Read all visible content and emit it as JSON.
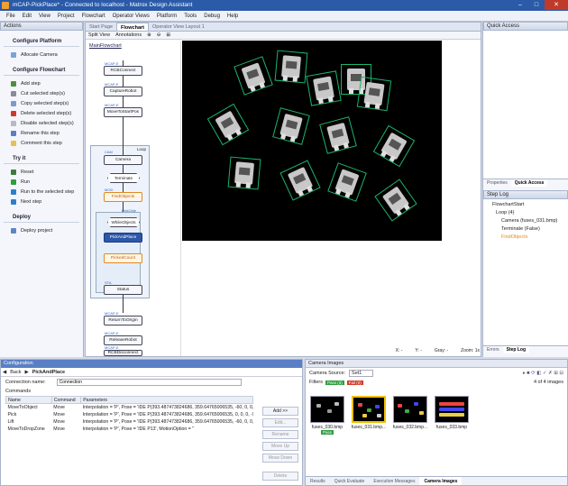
{
  "window": {
    "title": "mCAP-PickPlace* - Connected to localhost - Matrox Design Assistant"
  },
  "menu": [
    "File",
    "Edit",
    "View",
    "Project",
    "Flowchart",
    "Operator Views",
    "Platform",
    "Tools",
    "Debug",
    "Help"
  ],
  "actions": {
    "title": "Actions",
    "sections": [
      {
        "title": "Configure Platform",
        "items": [
          "Allocate Camera"
        ]
      },
      {
        "title": "Configure Flowchart",
        "items": [
          "Add step",
          "Cut selected step(s)",
          "Copy selected step(s)",
          "Delete selected step(s)",
          "Disable selected step(s)",
          "Rename this step",
          "Comment this step"
        ]
      },
      {
        "title": "Try it",
        "items": [
          "Reset",
          "Run",
          "Run to the selected step",
          "Next step"
        ]
      },
      {
        "title": "Deploy",
        "items": [
          "Deploy project"
        ]
      }
    ]
  },
  "center": {
    "tabs": [
      "Start Page",
      "Flowchart",
      "Operator View Layout 1"
    ],
    "toolbar": [
      "Split View",
      "Annotations"
    ],
    "flow_title": "MainFlowchart",
    "loop_label": "Loop",
    "nodes": {
      "rcbconnect": "RCBConnect",
      "capture": "CaptureRobot",
      "movetostart": "MoveToStartPos",
      "camera": "Camera",
      "terminate": "Terminate",
      "findobjects": "FindObjects",
      "whileobjects": "WhileObjects",
      "pickandplace": "PickAndPlace",
      "pickedcount": "PickedCount",
      "status": "Status",
      "returntoorigin": "ReturnToOrigin",
      "releaserobot": "ReleaseRobot",
      "rcbdisconnect": "RCBDisconnect"
    },
    "tags": {
      "mcap": "MCAP-E",
      "cam": "CAM",
      "mod": "MOD",
      "pick": "PickObje",
      "sta": "STA"
    },
    "coords": {
      "x": "X: -",
      "y": "Y: -",
      "gray": "Gray: -",
      "zoom": "Zoom: 1x"
    }
  },
  "right": {
    "quick_access": "Quick Access",
    "tabs1": [
      "Properties",
      "Quick Access"
    ],
    "step_log": "Step Log",
    "tree": [
      "FlowchartStart",
      "Loop (4)",
      "Camera (fuses_031.bmp)",
      "Terminate (False)",
      "FindObjects"
    ],
    "tabs2": [
      "Errors",
      "Step Log"
    ]
  },
  "config": {
    "title": "Configuration",
    "back": "Back",
    "crumb": "PickAndPlace",
    "conn_label": "Connection name:",
    "conn_value": "Connection",
    "commands_label": "Commands",
    "headers": [
      "Name",
      "Command",
      "Parameters"
    ],
    "rows": [
      [
        "MoveToObject",
        "Move",
        "Interpolation = 'P', Pose = 'IDE P(393.487473824686, 359.64765006535, -60, 0, 0, -9"
      ],
      [
        "Pick",
        "Move",
        "Interpolation = 'P', Pose = 'IDE P(393.487473824686, 359.64765006535, 0, 0, 0, -90"
      ],
      [
        "Lift",
        "Move",
        "Interpolation = 'P', Pose = 'IDE P(393.487473824686, 359.64765006535, -60, 0, 0, -9"
      ],
      [
        "MoveToDropZone",
        "Move",
        "Interpolation = 'P', Pose = 'IDE P13', MotionOption = ''"
      ]
    ],
    "buttons": [
      "Add >>",
      "Edit...",
      "Rename",
      "Move Up",
      "Move Down",
      "Delete"
    ]
  },
  "camera_images": {
    "title": "Camera Images",
    "source_label": "Camera Source:",
    "source_value": "Set1",
    "filters_label": "Filters",
    "pass": "Pass (3)",
    "fail": "Fail (0)",
    "count": "4 of 4 images",
    "thumbs": [
      "fuses_030.bmp",
      "fuses_031.bmp...",
      "fuses_032.bmp...",
      "fuses_033.bmp"
    ],
    "pass_badge": "Pass",
    "tabs": [
      "Results",
      "Quick Evaluate",
      "Execution Messages",
      "Camera Images"
    ]
  }
}
